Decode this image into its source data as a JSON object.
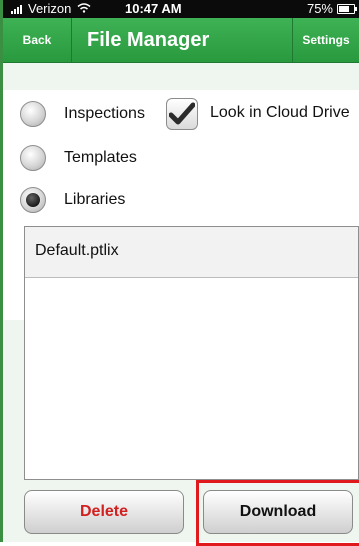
{
  "status_bar": {
    "carrier": "Verizon",
    "time": "10:47 AM",
    "battery": "75%"
  },
  "nav": {
    "back_label": "Back",
    "title": "File Manager",
    "settings_label": "Settings"
  },
  "options": {
    "inspections_label": "Inspections",
    "look_in_cloud_label": "Look in Cloud Drive",
    "templates_label": "Templates",
    "libraries_label": "Libraries",
    "selected": "Libraries",
    "look_in_cloud_checked": true
  },
  "file_list": {
    "items": [
      {
        "name": "Default.ptlix"
      }
    ]
  },
  "actions": {
    "delete_label": "Delete",
    "download_label": "Download"
  },
  "colors": {
    "nav_green": "#2fa646",
    "delete_red": "#d12020",
    "highlight_red": "#e0191d"
  }
}
